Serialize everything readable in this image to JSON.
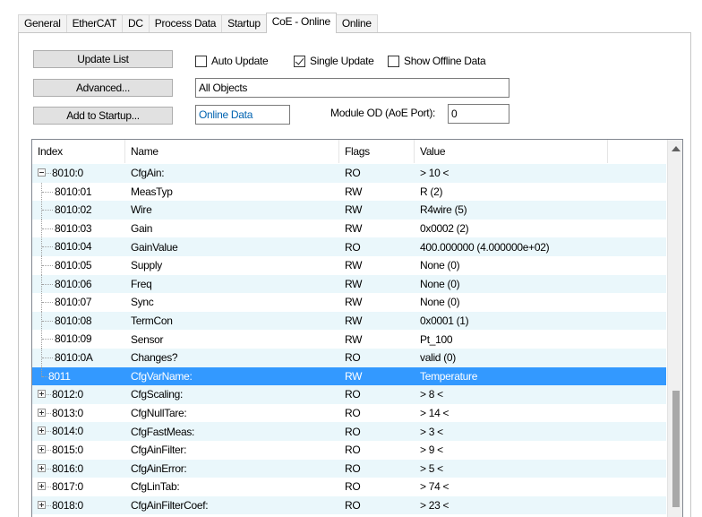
{
  "tabs": [
    "General",
    "EtherCAT",
    "DC",
    "Process Data",
    "Startup",
    "CoE - Online",
    "Online"
  ],
  "active_tab": "CoE - Online",
  "buttons": {
    "update_list": "Update List",
    "advanced": "Advanced...",
    "add_to_startup": "Add to Startup..."
  },
  "checkboxes": {
    "auto_update": {
      "label": "Auto Update",
      "checked": false
    },
    "single_update": {
      "label": "Single Update",
      "checked": true
    },
    "show_offline": {
      "label": "Show Offline Data",
      "checked": false
    }
  },
  "fields": {
    "filter": "All Objects",
    "data_source": "Online Data",
    "module_od_label": "Module OD (AoE Port):",
    "module_od_value": "0"
  },
  "table": {
    "columns": [
      "Index",
      "Name",
      "Flags",
      "Value"
    ],
    "rows": [
      {
        "index": "8010:0",
        "name": "CfgAin:",
        "flags": "RO",
        "value": "> 10 <",
        "level": 0,
        "expander": "minus"
      },
      {
        "index": "8010:01",
        "name": "MeasTyp",
        "flags": "RW",
        "value": "R (2)",
        "level": 1
      },
      {
        "index": "8010:02",
        "name": "Wire",
        "flags": "RW",
        "value": "R4wire (5)",
        "level": 1
      },
      {
        "index": "8010:03",
        "name": "Gain",
        "flags": "RW",
        "value": "0x0002 (2)",
        "level": 1
      },
      {
        "index": "8010:04",
        "name": "GainValue",
        "flags": "RO",
        "value": "400.000000  (4.000000e+02)",
        "level": 1
      },
      {
        "index": "8010:05",
        "name": "Supply",
        "flags": "RW",
        "value": "None (0)",
        "level": 1
      },
      {
        "index": "8010:06",
        "name": "Freq",
        "flags": "RW",
        "value": "None (0)",
        "level": 1
      },
      {
        "index": "8010:07",
        "name": "Sync",
        "flags": "RW",
        "value": "None (0)",
        "level": 1
      },
      {
        "index": "8010:08",
        "name": "TermCon",
        "flags": "RW",
        "value": "0x0001 (1)",
        "level": 1
      },
      {
        "index": "8010:09",
        "name": "Sensor",
        "flags": "RW",
        "value": "Pt_100",
        "level": 1
      },
      {
        "index": "8010:0A",
        "name": "Changes?",
        "flags": "RO",
        "value": "valid (0)",
        "level": 1
      },
      {
        "index": "8011",
        "name": "CfgVarName:",
        "flags": "RW",
        "value": "Temperature",
        "level": 0,
        "expander": "none",
        "selected": true
      },
      {
        "index": "8012:0",
        "name": "CfgScaling:",
        "flags": "RO",
        "value": "> 8 <",
        "level": 0,
        "expander": "plus"
      },
      {
        "index": "8013:0",
        "name": "CfgNullTare:",
        "flags": "RO",
        "value": "> 14 <",
        "level": 0,
        "expander": "plus"
      },
      {
        "index": "8014:0",
        "name": "CfgFastMeas:",
        "flags": "RO",
        "value": "> 3 <",
        "level": 0,
        "expander": "plus"
      },
      {
        "index": "8015:0",
        "name": "CfgAinFilter:",
        "flags": "RO",
        "value": "> 9 <",
        "level": 0,
        "expander": "plus"
      },
      {
        "index": "8016:0",
        "name": "CfgAinError:",
        "flags": "RO",
        "value": "> 5 <",
        "level": 0,
        "expander": "plus"
      },
      {
        "index": "8017:0",
        "name": "CfgLinTab:",
        "flags": "RO",
        "value": "> 74 <",
        "level": 0,
        "expander": "plus"
      },
      {
        "index": "8018:0",
        "name": "CfgAinFilterCoef:",
        "flags": "RO",
        "value": "> 23 <",
        "level": 0,
        "expander": "plus"
      }
    ]
  },
  "colors": {
    "selection": "#3399ff",
    "alt_row": "#eaf7fb",
    "data_field_text": "#0063b1"
  }
}
